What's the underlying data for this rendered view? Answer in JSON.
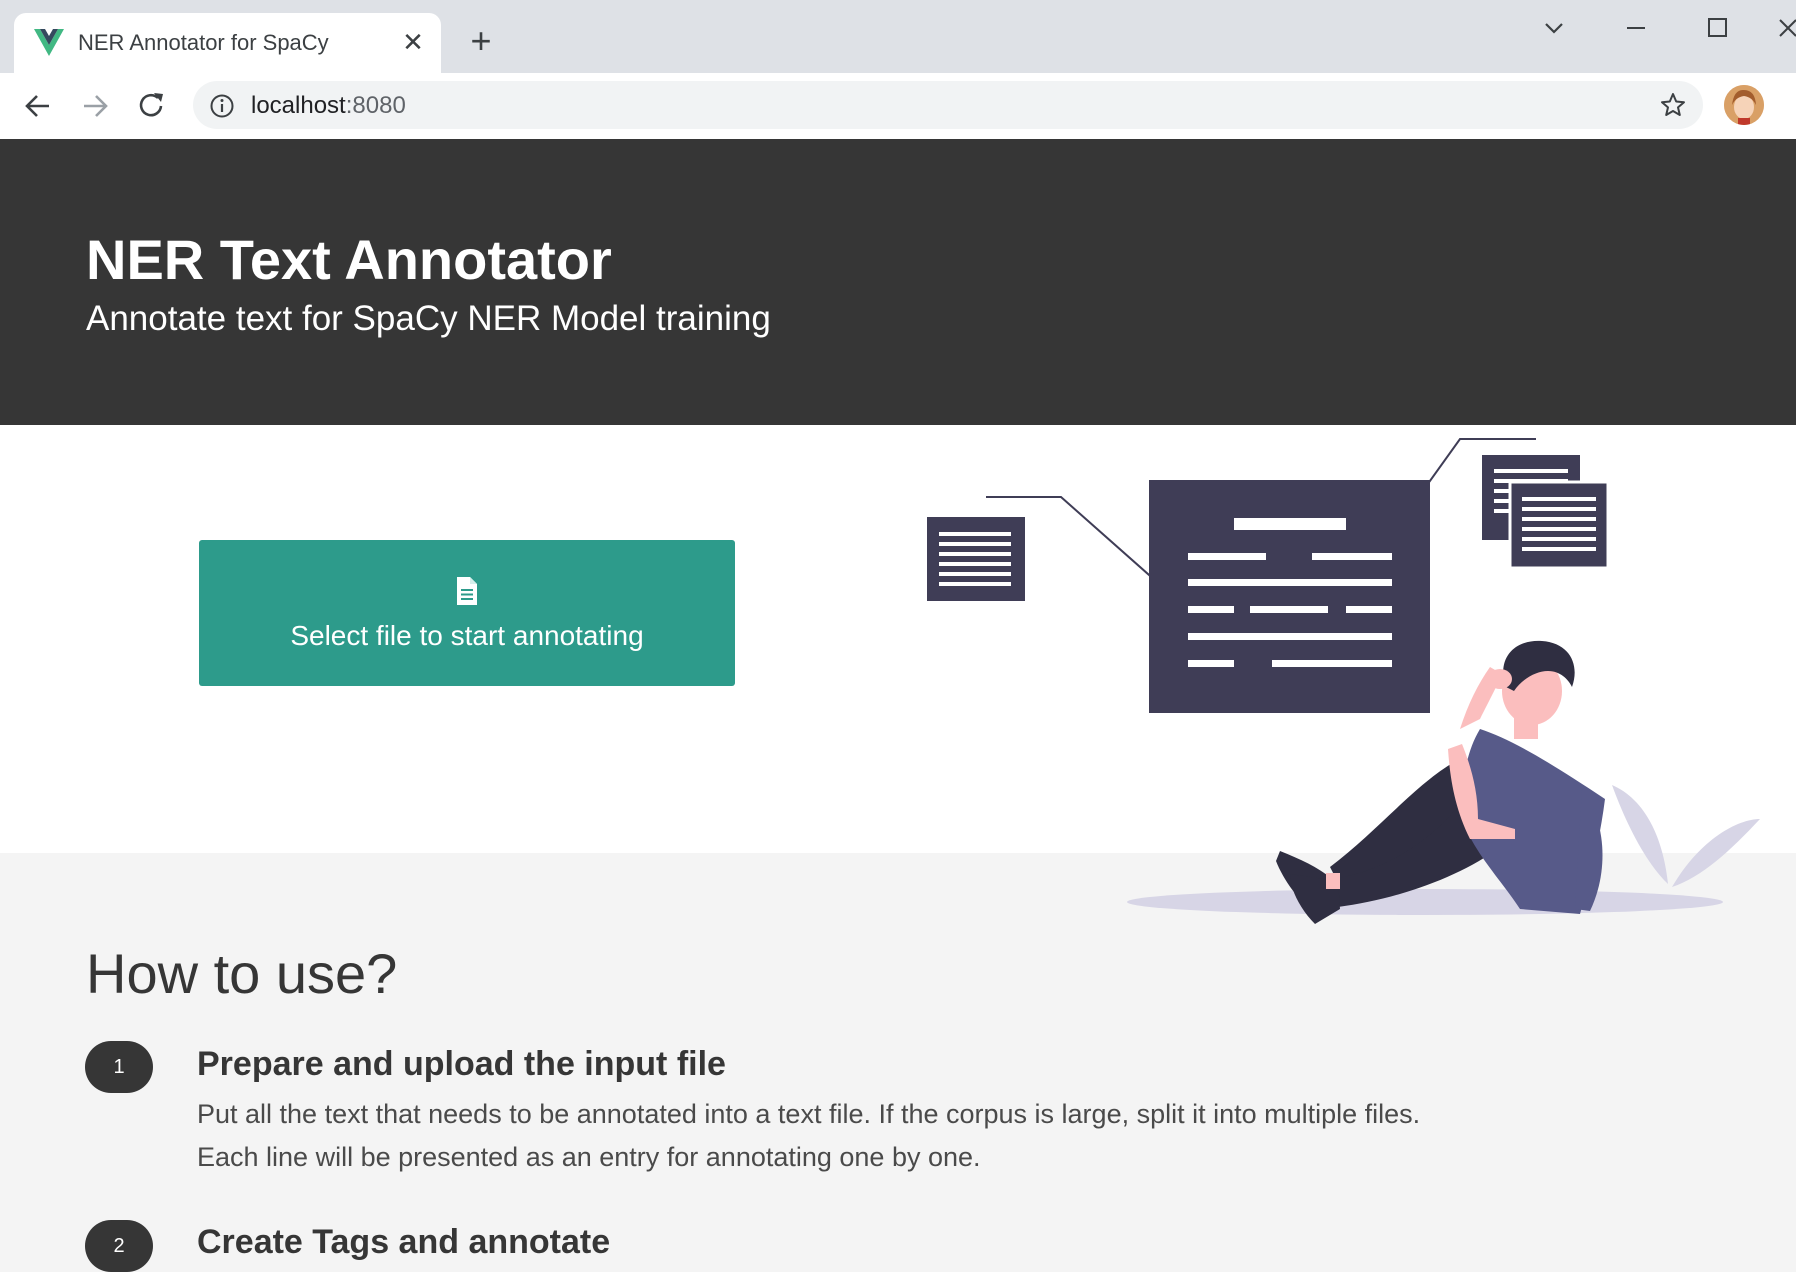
{
  "browser": {
    "tab_title": "NER Annotator for SpaCy",
    "close_tab_symbol": "✕",
    "new_tab_symbol": "+",
    "url_host": "localhost",
    "url_port": ":8080",
    "icons": [
      "vue-favicon-icon",
      "close-icon",
      "plus-icon",
      "chevron-down-icon",
      "minimize-icon",
      "maximize-icon",
      "back-arrow-icon",
      "forward-arrow-icon",
      "reload-icon",
      "info-icon",
      "star-icon",
      "profile-avatar"
    ]
  },
  "hero": {
    "title": "NER Text Annotator",
    "subtitle": "Annotate text for SpaCy NER Model training"
  },
  "upload": {
    "button_label": "Select file to start annotating",
    "button_icon": "file-icon",
    "button_color": "#2d9b8b"
  },
  "howto": {
    "title": "How to use?",
    "steps": [
      {
        "number": "1",
        "title": "Prepare and upload the input file",
        "line1": "Put all the text that needs to be annotated into a text file. If the corpus is large, split it into multiple files.",
        "line2": "Each line will be presented as an entry for annotating one by one."
      },
      {
        "number": "2",
        "title": "Create Tags and annotate"
      }
    ]
  },
  "colors": {
    "hero_bg": "#363636",
    "illustration_dark": "#3f3d56",
    "illustration_accent": "#6c63ff",
    "page_bg": "#f4f4f4"
  }
}
